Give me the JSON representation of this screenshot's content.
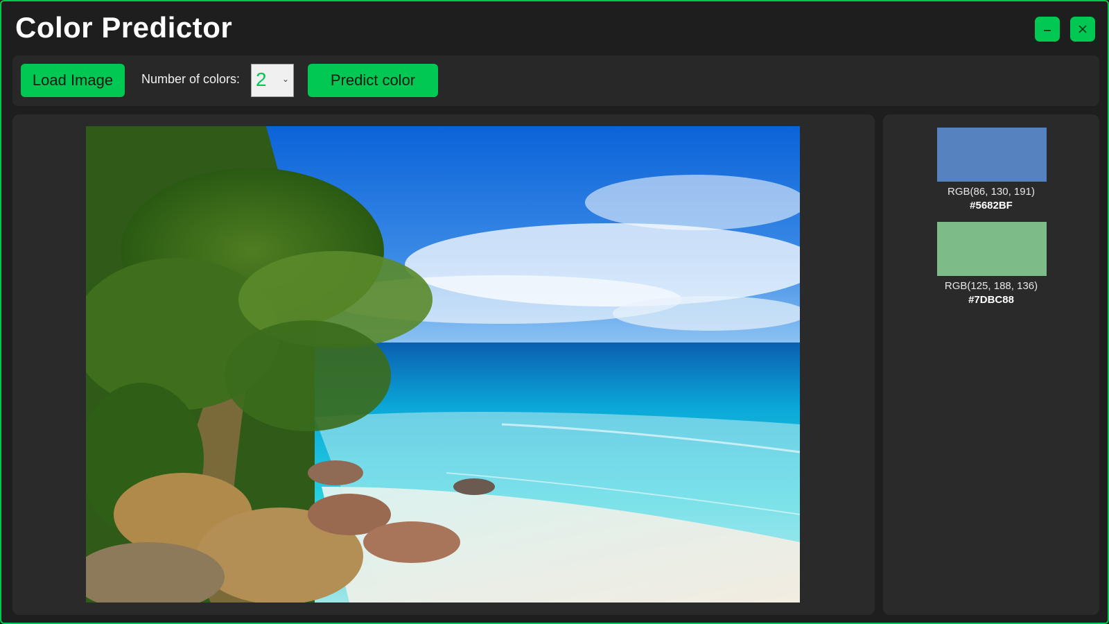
{
  "app": {
    "title": "Color Predictor",
    "accent_color": "#00C853",
    "window_controls": [
      "minimize-icon",
      "close-icon"
    ]
  },
  "toolbar": {
    "load_label": "Load Image",
    "num_colors_label": "Number of colors:",
    "num_colors_value": "2",
    "predict_label": "Predict color"
  },
  "image": {
    "description_icon": "beach-photo"
  },
  "swatches": [
    {
      "rgb": "RGB(86, 130, 191)",
      "hex": "#5682BF",
      "color": "#5682BF"
    },
    {
      "rgb": "RGB(125, 188, 136)",
      "hex": "#7DBC88",
      "color": "#7DBC88"
    }
  ]
}
